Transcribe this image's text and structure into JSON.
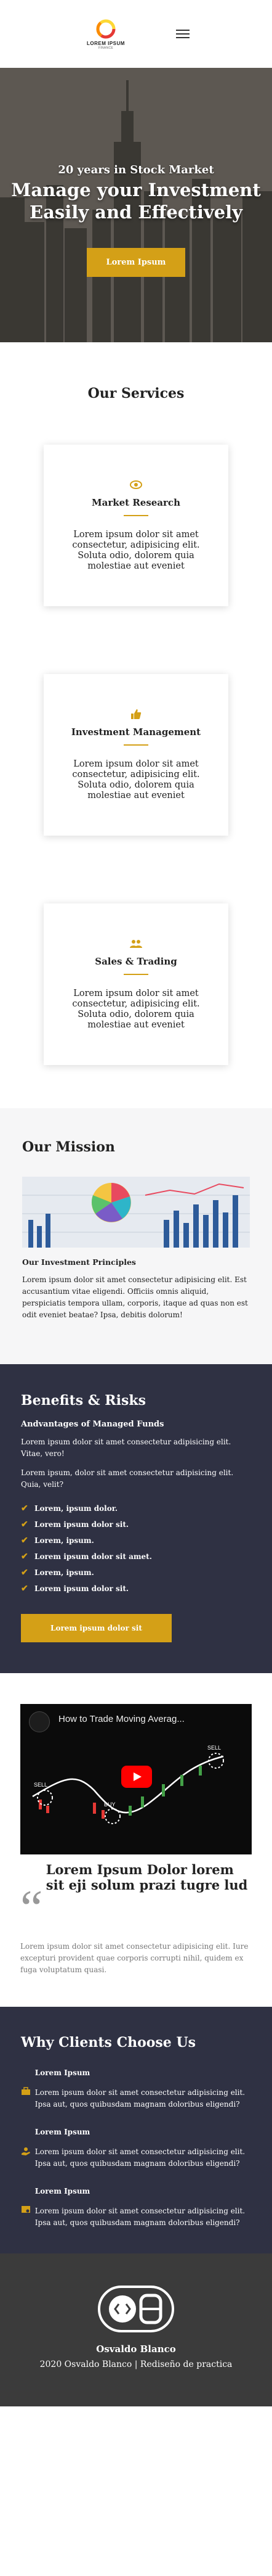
{
  "header": {
    "logo_title": "LOREM IPSUM",
    "logo_sub": "FINANCE"
  },
  "hero": {
    "kicker": "20 years in Stock Market",
    "title": "Manage your Investment Easily and Effectively",
    "button": "Lorem Ipsum"
  },
  "services": {
    "heading": "Our Services",
    "cards": [
      {
        "icon": "eye-icon",
        "title": "Market Research",
        "text": "Lorem ipsum dolor sit amet consectetur, adipisicing elit. Soluta odio, dolorem quia molestiae aut eveniet"
      },
      {
        "icon": "thumbs-up-icon",
        "title": "Investment Management",
        "text": "Lorem ipsum dolor sit amet consectetur, adipisicing elit. Soluta odio, dolorem quia molestiae aut eveniet"
      },
      {
        "icon": "users-icon",
        "title": "Sales & Trading",
        "text": "Lorem ipsum dolor sit amet consectetur, adipisicing elit. Soluta odio, dolorem quia molestiae aut eveniet"
      }
    ]
  },
  "mission": {
    "heading": "Our Mission",
    "subheading": "Our Investment Principles",
    "text": "Lorem ipsum dolor sit amet consectetur adipisicing elit. Est accusantium vitae eligendi. Officiis omnis aliquid, perspiciatis tempora ullam, corporis, itaque ad quas non est odit eveniet beatae? Ipsa, debitis dolorum!"
  },
  "benefits": {
    "heading": "Benefits & Risks",
    "subheading": "Andvantages of Managed Funds",
    "p1": "Lorem ipsum dolor sit amet consectetur adipisicing elit. Vitae, vero!",
    "p2": "Lorem ipsum, dolor sit amet consectetur adipisicing elit. Quia, velit?",
    "items": [
      "Lorem, ipsum dolor.",
      "Lorem ipsum dolor sit.",
      "Lorem, ipsum.",
      "Lorem ipsum dolor sit amet.",
      "Lorem, ipsum.",
      "Lorem ipsum dolor sit."
    ],
    "button": "Lorem ipsum dolor sit"
  },
  "video": {
    "title": "How to Trade Moving Averag...",
    "label_sell": "SELL",
    "label_buy": "BUY",
    "quote": "Lorem Ipsum Dolor lorem sit eji solum prazi tugre lud",
    "text": "Lorem ipsum dolor sit amet consectetur adipisicing elit. Iure excepturi provident quae corporis corrupti nihil, quidem ex fuga voluptatum quasi."
  },
  "why": {
    "heading": "Why Clients Choose Us",
    "items": [
      {
        "icon": "briefcase-icon",
        "title": "Lorem Ipsum",
        "text": "Lorem ipsum dolor sit amet consectetur adipisicing elit. Ipsa aut, quos quibusdam magnam doloribus eligendi?"
      },
      {
        "icon": "hand-coin-icon",
        "title": "Lorem Ipsum",
        "text": "Lorem ipsum dolor sit amet consectetur adipisicing elit. Ipsa aut, quos quibusdam magnam doloribus eligendi?"
      },
      {
        "icon": "certificate-icon",
        "title": "Lorem Ipsum",
        "text": "Lorem ipsum dolor sit amet consectetur adipisicing elit. Ipsa aut, quos quibusdam magnam doloribus eligendi?"
      }
    ]
  },
  "footer": {
    "name": "Osvaldo Blanco",
    "copyright": "2020 Osvaldo Blanco | Rediseño de practica"
  },
  "colors": {
    "accent": "#d4a017",
    "dark": "#2f3143",
    "footer": "#3b3b3b"
  }
}
